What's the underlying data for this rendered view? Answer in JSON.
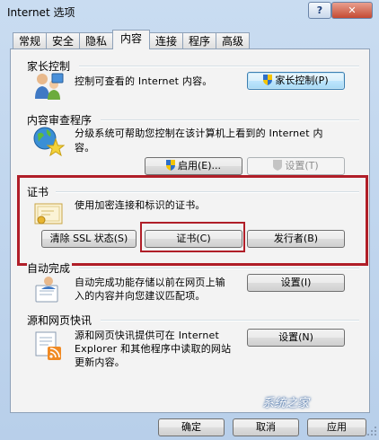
{
  "window": {
    "title": "Internet 选项"
  },
  "titlebar": {
    "help_label": "?",
    "close_label": "✕"
  },
  "tabs": [
    {
      "label": "常规",
      "active": false
    },
    {
      "label": "安全",
      "active": false
    },
    {
      "label": "隐私",
      "active": false
    },
    {
      "label": "内容",
      "active": true
    },
    {
      "label": "连接",
      "active": false
    },
    {
      "label": "程序",
      "active": false
    },
    {
      "label": "高级",
      "active": false
    }
  ],
  "parental": {
    "title": "家长控制",
    "description": "控制可查看的 Internet 内容。",
    "button": "家长控制(P)",
    "icon": "parental-control-icon"
  },
  "advisor": {
    "title": "内容审查程序",
    "description_line1": "分级系统可帮助您控制在该计算机上看到的 Internet 内",
    "description_line2": "容。",
    "enable_button": "启用(E)...",
    "settings_button": "设置(T)",
    "icon": "content-advisor-icon"
  },
  "certificates": {
    "title": "证书",
    "description": "使用加密连接和标识的证书。",
    "clear_ssl_button": "清除 SSL 状态(S)",
    "certificates_button": "证书(C)",
    "publishers_button": "发行者(B)",
    "icon": "certificate-icon"
  },
  "autocomplete": {
    "title": "自动完成",
    "description_line1": "自动完成功能存储以前在网页上输",
    "description_line2": "入的内容并向您建议匹配项。",
    "button": "设置(I)",
    "icon": "autocomplete-icon"
  },
  "feeds": {
    "title": "源和网页快讯",
    "description_line1": "源和网页快讯提供可在 Internet",
    "description_line2": "Explorer 和其他程序中读取的网站",
    "description_line3": "更新内容。",
    "button": "设置(N)",
    "icon": "feeds-icon"
  },
  "footer": {
    "ok_button": "确定",
    "cancel_button": "取消",
    "apply_button": "应用"
  },
  "watermark": "系统之家",
  "colors": {
    "highlight_red": "#b01e28",
    "panel": "#f3f3f3",
    "frame": "#c9dcf1"
  }
}
